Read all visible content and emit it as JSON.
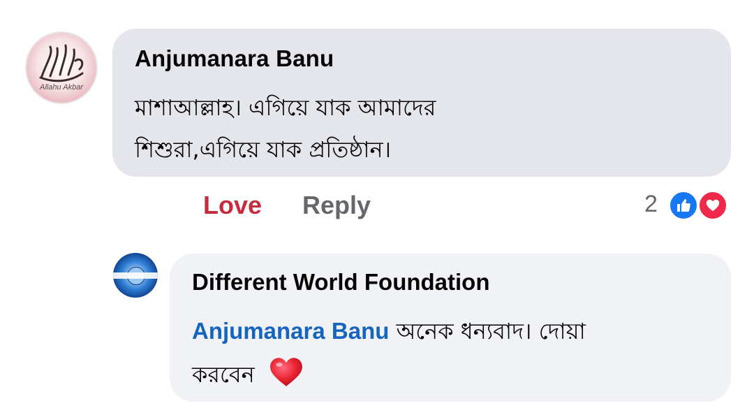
{
  "comment": {
    "avatar_caption": "Allahu Akbar",
    "author": "Anjumanara Banu",
    "text_line1": "মাশাআল্লাহ। এগিয়ে যাক আমাদের",
    "text_line2": "শিশুরা,এগিয়ে যাক প্রতিষ্ঠান।",
    "actions": {
      "love_label": "Love",
      "reply_label": "Reply"
    },
    "reactions": {
      "count": "2",
      "types": [
        "like-icon",
        "love-icon"
      ]
    }
  },
  "reply": {
    "author": "Different World Foundation",
    "mention": "Anjumanara Banu",
    "text_line1_rest": " অনেক ধন্যবাদ। দোয়া",
    "text_line2": "করবেন",
    "emoji": "red-heart-icon"
  },
  "colors": {
    "bubble_main": "#e4e6eb",
    "bubble_reply": "#f0f2f5",
    "love_active": "#c62c3f",
    "action_gray": "#65676b",
    "mention_blue": "#1565c0",
    "like_blue": "#1877f2",
    "heart_red": "#f02849"
  }
}
